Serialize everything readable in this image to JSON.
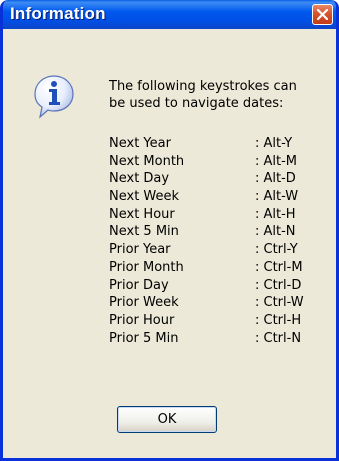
{
  "window": {
    "title": "Information"
  },
  "message": {
    "line1": "The following keystrokes can",
    "line2": "be used to navigate dates:"
  },
  "shortcuts": [
    {
      "label": "Next Year",
      "keys": ": Alt-Y"
    },
    {
      "label": "Next Month",
      "keys": ": Alt-M"
    },
    {
      "label": "Next Day",
      "keys": ": Alt-D"
    },
    {
      "label": "Next Week",
      "keys": ": Alt-W"
    },
    {
      "label": "Next Hour",
      "keys": ": Alt-H"
    },
    {
      "label": "Next 5 Min",
      "keys": ": Alt-N"
    },
    {
      "label": "Prior Year",
      "keys": ": Ctrl-Y"
    },
    {
      "label": "Prior Month",
      "keys": ": Ctrl-M"
    },
    {
      "label": "Prior Day",
      "keys": ": Ctrl-D"
    },
    {
      "label": "Prior Week",
      "keys": ": Ctrl-W"
    },
    {
      "label": "Prior Hour",
      "keys": ": Ctrl-H"
    },
    {
      "label": "Prior 5 Min",
      "keys": ": Ctrl-N"
    }
  ],
  "buttons": {
    "ok_label": "OK"
  },
  "icons": {
    "info": "info-icon",
    "close": "close-icon"
  },
  "colors": {
    "titlebar": "#0058ee",
    "frame": "#0831d9",
    "dialog_bg": "#ece9d8",
    "close_button": "#d6542d"
  }
}
